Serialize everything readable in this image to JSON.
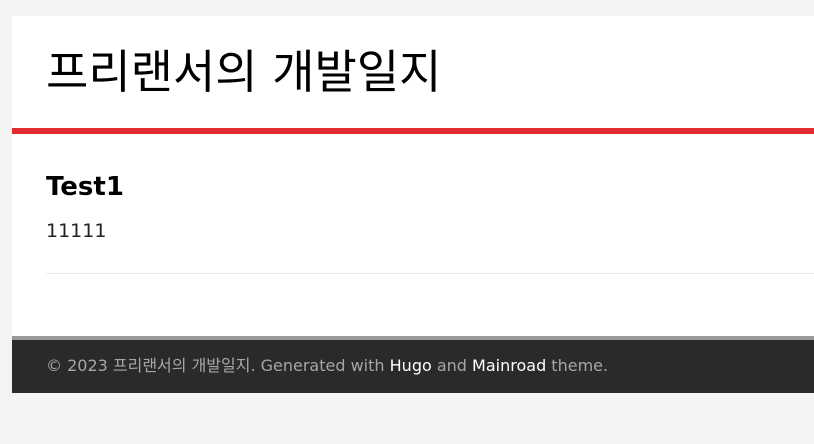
{
  "header": {
    "site_title": "프리랜서의 개발일지"
  },
  "post": {
    "title": "Test1",
    "content": "11111"
  },
  "footer": {
    "copyright": "© 2023 프리랜서의 개발일지. Generated with ",
    "hugo_link": "Hugo",
    "and_text": " and ",
    "mainroad_link": "Mainroad",
    "theme_text": " theme."
  },
  "colors": {
    "accent": "#e22d30",
    "footer_bg": "#2a2a2a",
    "page_bg": "#f3f3f3"
  }
}
